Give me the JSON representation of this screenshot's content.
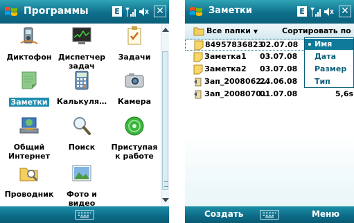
{
  "left": {
    "title": "Программы",
    "status_badge": "E",
    "ok_label": "✕",
    "apps": [
      {
        "label": "Диктофон",
        "icon": "dictaphone-icon"
      },
      {
        "label": "Диспетчер задач",
        "icon": "task-manager-icon"
      },
      {
        "label": "Задачи",
        "icon": "tasks-icon"
      },
      {
        "label": "Заметки",
        "icon": "notes-icon",
        "selected": true
      },
      {
        "label": "Калькуля…",
        "icon": "calculator-icon"
      },
      {
        "label": "Камера",
        "icon": "camera-icon"
      },
      {
        "label": "Общий Интернет",
        "icon": "internet-sharing-icon"
      },
      {
        "label": "Поиск",
        "icon": "search-icon"
      },
      {
        "label": "Приступая к работе",
        "icon": "getting-started-icon"
      },
      {
        "label": "Проводник",
        "icon": "file-explorer-icon"
      },
      {
        "label": "Фото и видео",
        "icon": "photos-videos-icon"
      }
    ]
  },
  "right": {
    "title": "Заметки",
    "status_badge": "E",
    "ok_label": "✕",
    "folder_label": "Все папки",
    "sort_label": "Сортировать по",
    "rows": [
      {
        "name": "84957836823",
        "date": "02.07.08",
        "size": "",
        "icon": "note-icon"
      },
      {
        "name": "Заметка1",
        "date": "03.07.08",
        "size": "",
        "icon": "note-icon"
      },
      {
        "name": "Заметка2",
        "date": "03.07.08",
        "size": "",
        "icon": "note-icon"
      },
      {
        "name": "Зап_2008062…",
        "date": "24.06.08",
        "size": "",
        "icon": "voice-note-icon"
      },
      {
        "name": "Зап_2008070…",
        "date": "01.07.08",
        "size": "5,6s",
        "icon": "voice-note-icon"
      }
    ],
    "sort_menu": [
      "Имя",
      "Дата",
      "Размер",
      "Тип"
    ],
    "left_soft": "Создать",
    "right_soft": "Меню"
  }
}
